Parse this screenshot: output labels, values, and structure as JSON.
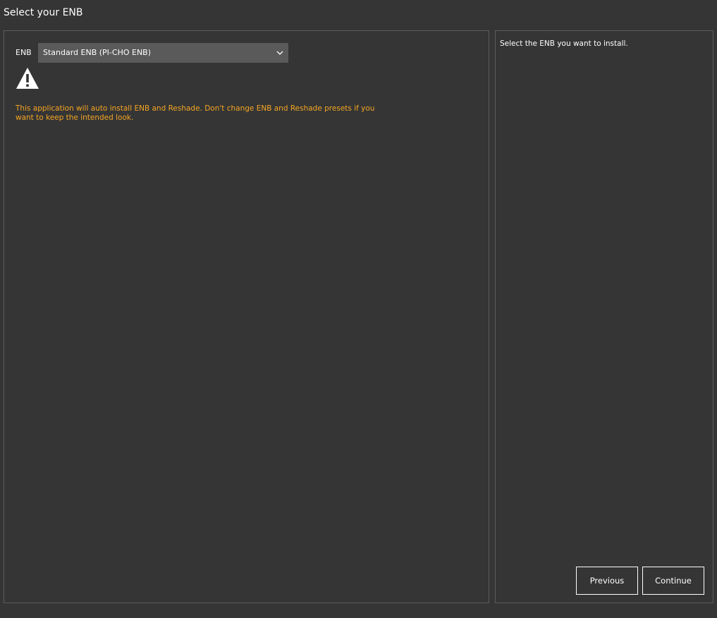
{
  "page": {
    "title": "Select your ENB"
  },
  "enb_selector": {
    "label": "ENB",
    "selected": "Standard ENB (PI-CHO ENB)",
    "icon": "chevron-down-icon"
  },
  "warning": {
    "icon": "warning-triangle-icon",
    "text": "This application will auto install ENB and Reshade. Don't change ENB and Reshade presets if you want to keep the intended look.",
    "color": "#f5a623"
  },
  "help": {
    "text": "Select the ENB you want to install."
  },
  "buttons": {
    "previous": "Previous",
    "continue": "Continue"
  },
  "colors": {
    "background": "#353535",
    "border": "#5c5c5c",
    "select_background": "#5a5a5a"
  }
}
